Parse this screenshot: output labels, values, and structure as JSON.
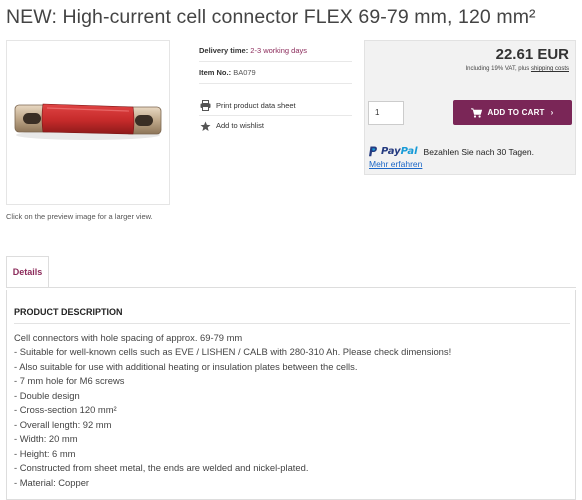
{
  "product": {
    "title": "NEW: High-current cell connector FLEX 69-79 mm, 120 mm²",
    "image_caption": "Click on the preview image for a larger view."
  },
  "info": {
    "delivery_label": "Delivery time:",
    "delivery_value": "2-3 working days",
    "item_label": "Item No.:",
    "item_value": "BA079",
    "print_label": "Print product data sheet",
    "wishlist_label": "Add to wishlist"
  },
  "buybox": {
    "price": "22.61 EUR",
    "vat_prefix": "Including 19% VAT, plus",
    "shipping_link": "shipping costs",
    "quantity": "1",
    "add_to_cart": "ADD TO CART",
    "paypal_logo_part1": "Pay",
    "paypal_logo_part2": "Pal",
    "paypal_text": "Bezahlen Sie nach 30 Tagen.",
    "paypal_more": "Mehr erfahren"
  },
  "tabs": [
    {
      "label": "Details"
    }
  ],
  "details": {
    "heading": "PRODUCT DESCRIPTION",
    "lines": [
      "Cell connectors with hole spacing of approx. 69-79 mm",
      "- Suitable for well-known cells such as EVE / LISHEN / CALB with 280-310 Ah. Please check dimensions!",
      "- Also suitable for use with additional heating or insulation plates between the cells.",
      "- 7 mm hole for M6 screws",
      "- Double design",
      "- Cross-section 120 mm²",
      "- Overall length: 92 mm",
      "- Width: 20 mm",
      "- Height: 6 mm",
      "- Constructed from sheet metal, the ends are welded and nickel-plated.",
      "- Material: Copper"
    ]
  },
  "colors": {
    "accent": "#7a2657",
    "link": "#1a66c7",
    "paypal_dark": "#253b80",
    "paypal_light": "#179bd7"
  },
  "icons": {
    "print": "printer-icon",
    "wishlist": "star-icon",
    "cart": "cart-icon",
    "paypal": "paypal-icon"
  }
}
